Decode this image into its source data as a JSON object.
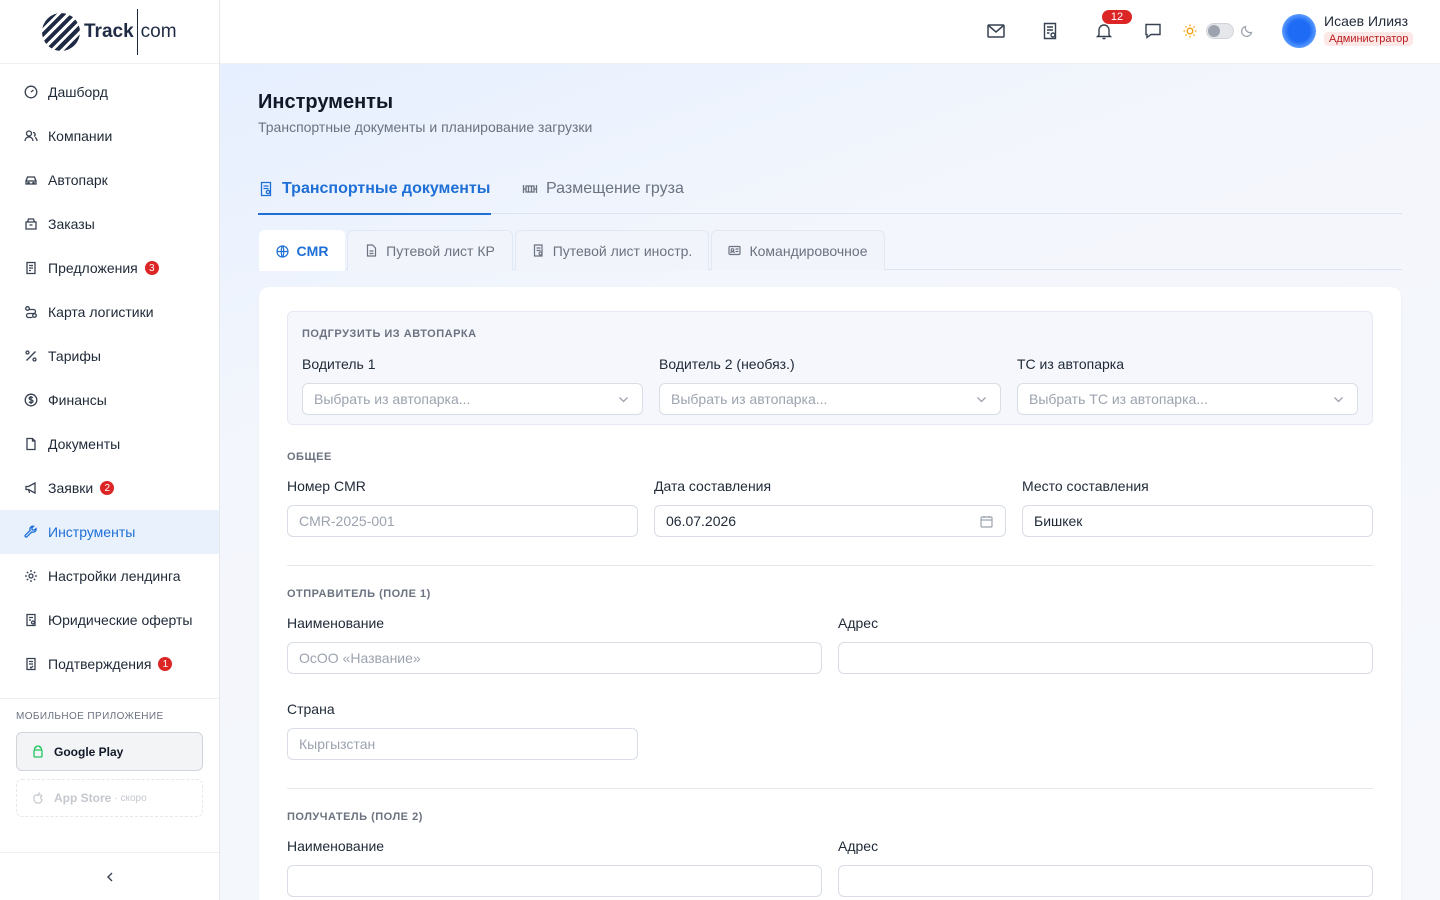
{
  "brand": {
    "name_left": "Track",
    "name_right": "com"
  },
  "sidebar": {
    "items": [
      {
        "label": "Дашборд",
        "icon": "dashboard-icon"
      },
      {
        "label": "Компании",
        "icon": "companies-icon"
      },
      {
        "label": "Автопарк",
        "icon": "car-icon"
      },
      {
        "label": "Заказы",
        "icon": "orders-icon"
      },
      {
        "label": "Предложения",
        "icon": "offers-icon",
        "badge": "3"
      },
      {
        "label": "Карта логистики",
        "icon": "route-icon"
      },
      {
        "label": "Тарифы",
        "icon": "percent-icon"
      },
      {
        "label": "Финансы",
        "icon": "finance-icon"
      },
      {
        "label": "Документы",
        "icon": "document-icon"
      },
      {
        "label": "Заявки",
        "icon": "megaphone-icon",
        "badge": "2"
      },
      {
        "label": "Инструменты",
        "icon": "wrench-icon",
        "active": true
      },
      {
        "label": "Настройки лендинга",
        "icon": "gear-icon"
      },
      {
        "label": "Юридические оферты",
        "icon": "legal-icon"
      },
      {
        "label": "Подтверждения",
        "icon": "confirm-icon",
        "badge": "1"
      }
    ],
    "mobile_title": "МОБИЛЬНОЕ ПРИЛОЖЕНИЕ",
    "google_play": "Google Play",
    "app_store": "App Store",
    "app_store_soon": "· скоро"
  },
  "topbar": {
    "notifications_count": "12",
    "user_name": "Исаев Илияз",
    "user_role": "Администратор"
  },
  "page": {
    "title": "Инструменты",
    "subtitle": "Транспортные документы и планирование загрузки",
    "tabs": [
      {
        "label": "Транспортные документы",
        "active": true
      },
      {
        "label": "Размещение груза",
        "active": false
      }
    ],
    "subtabs": [
      {
        "label": "CMR",
        "active": true
      },
      {
        "label": "Путевой лист КР"
      },
      {
        "label": "Путевой лист иностр."
      },
      {
        "label": "Командировочное"
      }
    ]
  },
  "form": {
    "fleet": {
      "title": "ПОДГРУЗИТЬ ИЗ АВТОПАРКА",
      "driver1_label": "Водитель 1",
      "driver1_placeholder": "Выбрать из автопарка...",
      "driver2_label": "Водитель 2 (необяз.)",
      "driver2_placeholder": "Выбрать из автопарка...",
      "vehicle_label": "ТС из автопарка",
      "vehicle_placeholder": "Выбрать ТС из автопарка..."
    },
    "general": {
      "title": "ОБЩЕЕ",
      "cmr_number_label": "Номер CMR",
      "cmr_number_placeholder": "CMR-2025-001",
      "date_label": "Дата составления",
      "date_value": "06.07.2026",
      "place_label": "Место составления",
      "place_value": "Бишкек"
    },
    "sender": {
      "title": "ОТПРАВИТЕЛЬ (ПОЛЕ 1)",
      "name_label": "Наименование",
      "name_placeholder": "ОсОО «Название»",
      "address_label": "Адрес",
      "address_value": "",
      "country_label": "Страна",
      "country_placeholder": "Кыргызстан"
    },
    "receiver": {
      "title": "ПОЛУЧАТЕЛЬ (ПОЛЕ 2)",
      "name_label": "Наименование",
      "name_value": "",
      "address_label": "Адрес",
      "address_value": ""
    }
  }
}
